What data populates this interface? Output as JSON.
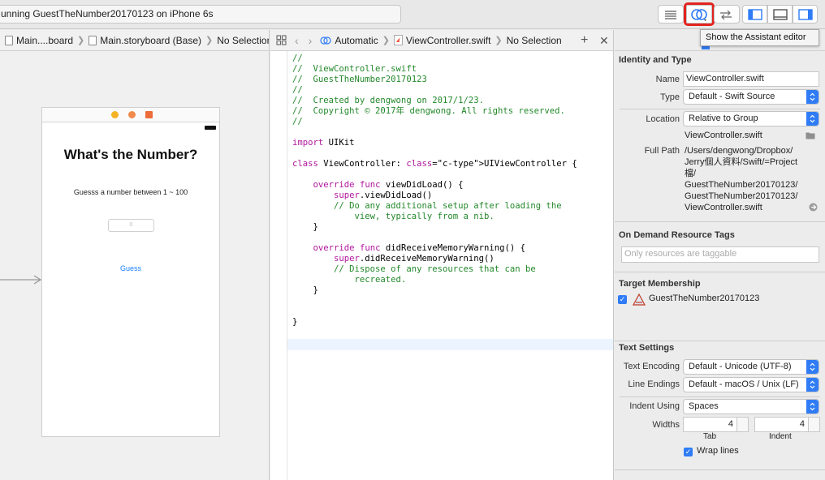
{
  "toolbar": {
    "status_text": "unning GuestTheNumber20170123 on iPhone 6s",
    "tooltip": "Show the Assistant editor"
  },
  "left_jumpbar": {
    "crumbs": [
      "Main....board",
      "Main.storyboard (Base)",
      "No Selection"
    ]
  },
  "editor_jumpbar": {
    "mode": "Automatic",
    "file": "ViewController.swift",
    "selection": "No Selection"
  },
  "storyboard": {
    "title": "What's the Number?",
    "prompt": "Guesss a number between 1 ~ 100",
    "input_placeholder": "0",
    "button_label": "Guess"
  },
  "code": {
    "lines": [
      "//",
      "//  ViewController.swift",
      "//  GuestTheNumber20170123",
      "//",
      "//  Created by dengwong on 2017/1/23.",
      "//  Copyright © 2017年 dengwong. All rights reserved.",
      "//",
      "",
      "import UIKit",
      "",
      "class ViewController: UIViewController {",
      "",
      "    override func viewDidLoad() {",
      "        super.viewDidLoad()",
      "        // Do any additional setup after loading the",
      "            view, typically from a nib.",
      "    }",
      "",
      "    override func didReceiveMemoryWarning() {",
      "        super.didReceiveMemoryWarning()",
      "        // Dispose of any resources that can be",
      "            recreated.",
      "    }",
      "",
      "",
      "}"
    ]
  },
  "inspector": {
    "identity": {
      "title": "Identity and Type",
      "name_label": "Name",
      "name_value": "ViewController.swift",
      "type_label": "Type",
      "type_value": "Default - Swift Source",
      "location_label": "Location",
      "location_value": "Relative to Group",
      "location_file": "ViewController.swift",
      "fullpath_label": "Full Path",
      "fullpath_lines": [
        "/Users/dengwong/Dropbox/",
        "Jerry個人資料/Swift/=Project",
        "檔/",
        "GuestTheNumber20170123/",
        "GuestTheNumber20170123/",
        "ViewController.swift"
      ]
    },
    "on_demand": {
      "title": "On Demand Resource Tags",
      "placeholder": "Only resources are taggable"
    },
    "target": {
      "title": "Target Membership",
      "target_name": "GuestTheNumber20170123"
    },
    "text_settings": {
      "title": "Text Settings",
      "encoding_label": "Text Encoding",
      "encoding_value": "Default - Unicode (UTF-8)",
      "endings_label": "Line Endings",
      "endings_value": "Default - macOS / Unix (LF)",
      "indent_label": "Indent Using",
      "indent_value": "Spaces",
      "widths_label": "Widths",
      "tab_value": "4",
      "indent_width_value": "4",
      "tab_caption": "Tab",
      "indent_caption": "Indent",
      "wrap_label": "Wrap lines"
    }
  },
  "colors": {
    "comment": "#23882b",
    "keyword": "#b0169c",
    "type": "#6c36a9",
    "accent": "#2f7cf6",
    "highlight": "#e3231e"
  },
  "icons": [
    "grid-icon",
    "back-icon",
    "forward-icon",
    "assistant-icon",
    "document-icon",
    "add-icon",
    "close-icon",
    "standard-editor-icon",
    "version-editor-icon",
    "navigator-toggle-icon",
    "debug-toggle-icon",
    "utilities-toggle-icon",
    "folder-icon",
    "reveal-arrow-icon",
    "app-target-icon"
  ]
}
